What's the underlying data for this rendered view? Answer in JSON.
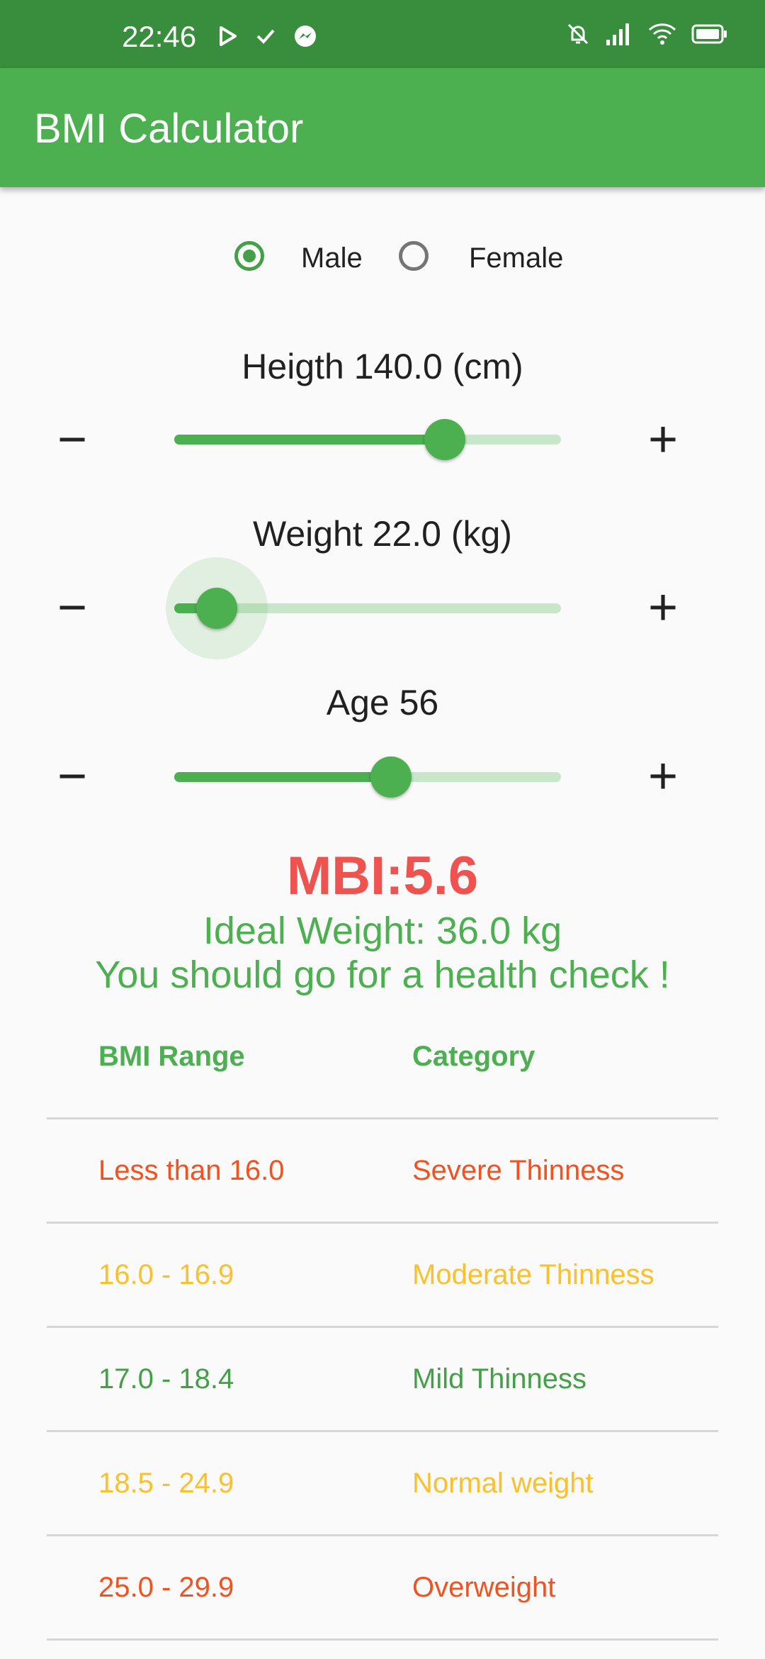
{
  "status_bar": {
    "time": "22:46",
    "left_icons": [
      "play-icon",
      "check-icon",
      "messenger-icon"
    ],
    "right_icons": [
      "bell-off-icon",
      "signal-icon",
      "wifi-icon",
      "battery-icon"
    ]
  },
  "app_bar": {
    "title": "BMI Calculator"
  },
  "gender": {
    "options": [
      {
        "label": "Male",
        "selected": true
      },
      {
        "label": "Female",
        "selected": false
      }
    ]
  },
  "sliders": [
    {
      "label": "Heigth 140.0 (cm)",
      "minus": "−",
      "plus": "+",
      "level": 0.7
    },
    {
      "label": "Weight 22.0 (kg)",
      "minus": "−",
      "plus": "+",
      "level": 0.11
    },
    {
      "label": "Age 56",
      "minus": "−",
      "plus": "+",
      "level": 0.56
    }
  ],
  "result": {
    "bmi": "MBI:5.6",
    "ideal_weight": "Ideal Weight: 36.0 kg",
    "advice": "You should go for a health check !"
  },
  "table": {
    "headers": [
      "BMI Range",
      "Category"
    ],
    "rows": [
      {
        "range": "Less than 16.0",
        "category": "Severe Thinness",
        "color": "#f4511e"
      },
      {
        "range": "16.0 - 16.9",
        "category": "Moderate Thinness",
        "color": "#fbc02d"
      },
      {
        "range": "17.0 - 18.4",
        "category": "Mild Thinness",
        "color": "#43a047"
      },
      {
        "range": "18.5 - 24.9",
        "category": "Normal weight",
        "color": "#fbc02d"
      },
      {
        "range": "25.0 - 29.9",
        "category": "Overweight",
        "color": "#f4511e"
      }
    ]
  },
  "colors": {
    "primary": "#4caf50",
    "primary_dark": "#388e3c",
    "bmi_value": "#ef5350"
  }
}
